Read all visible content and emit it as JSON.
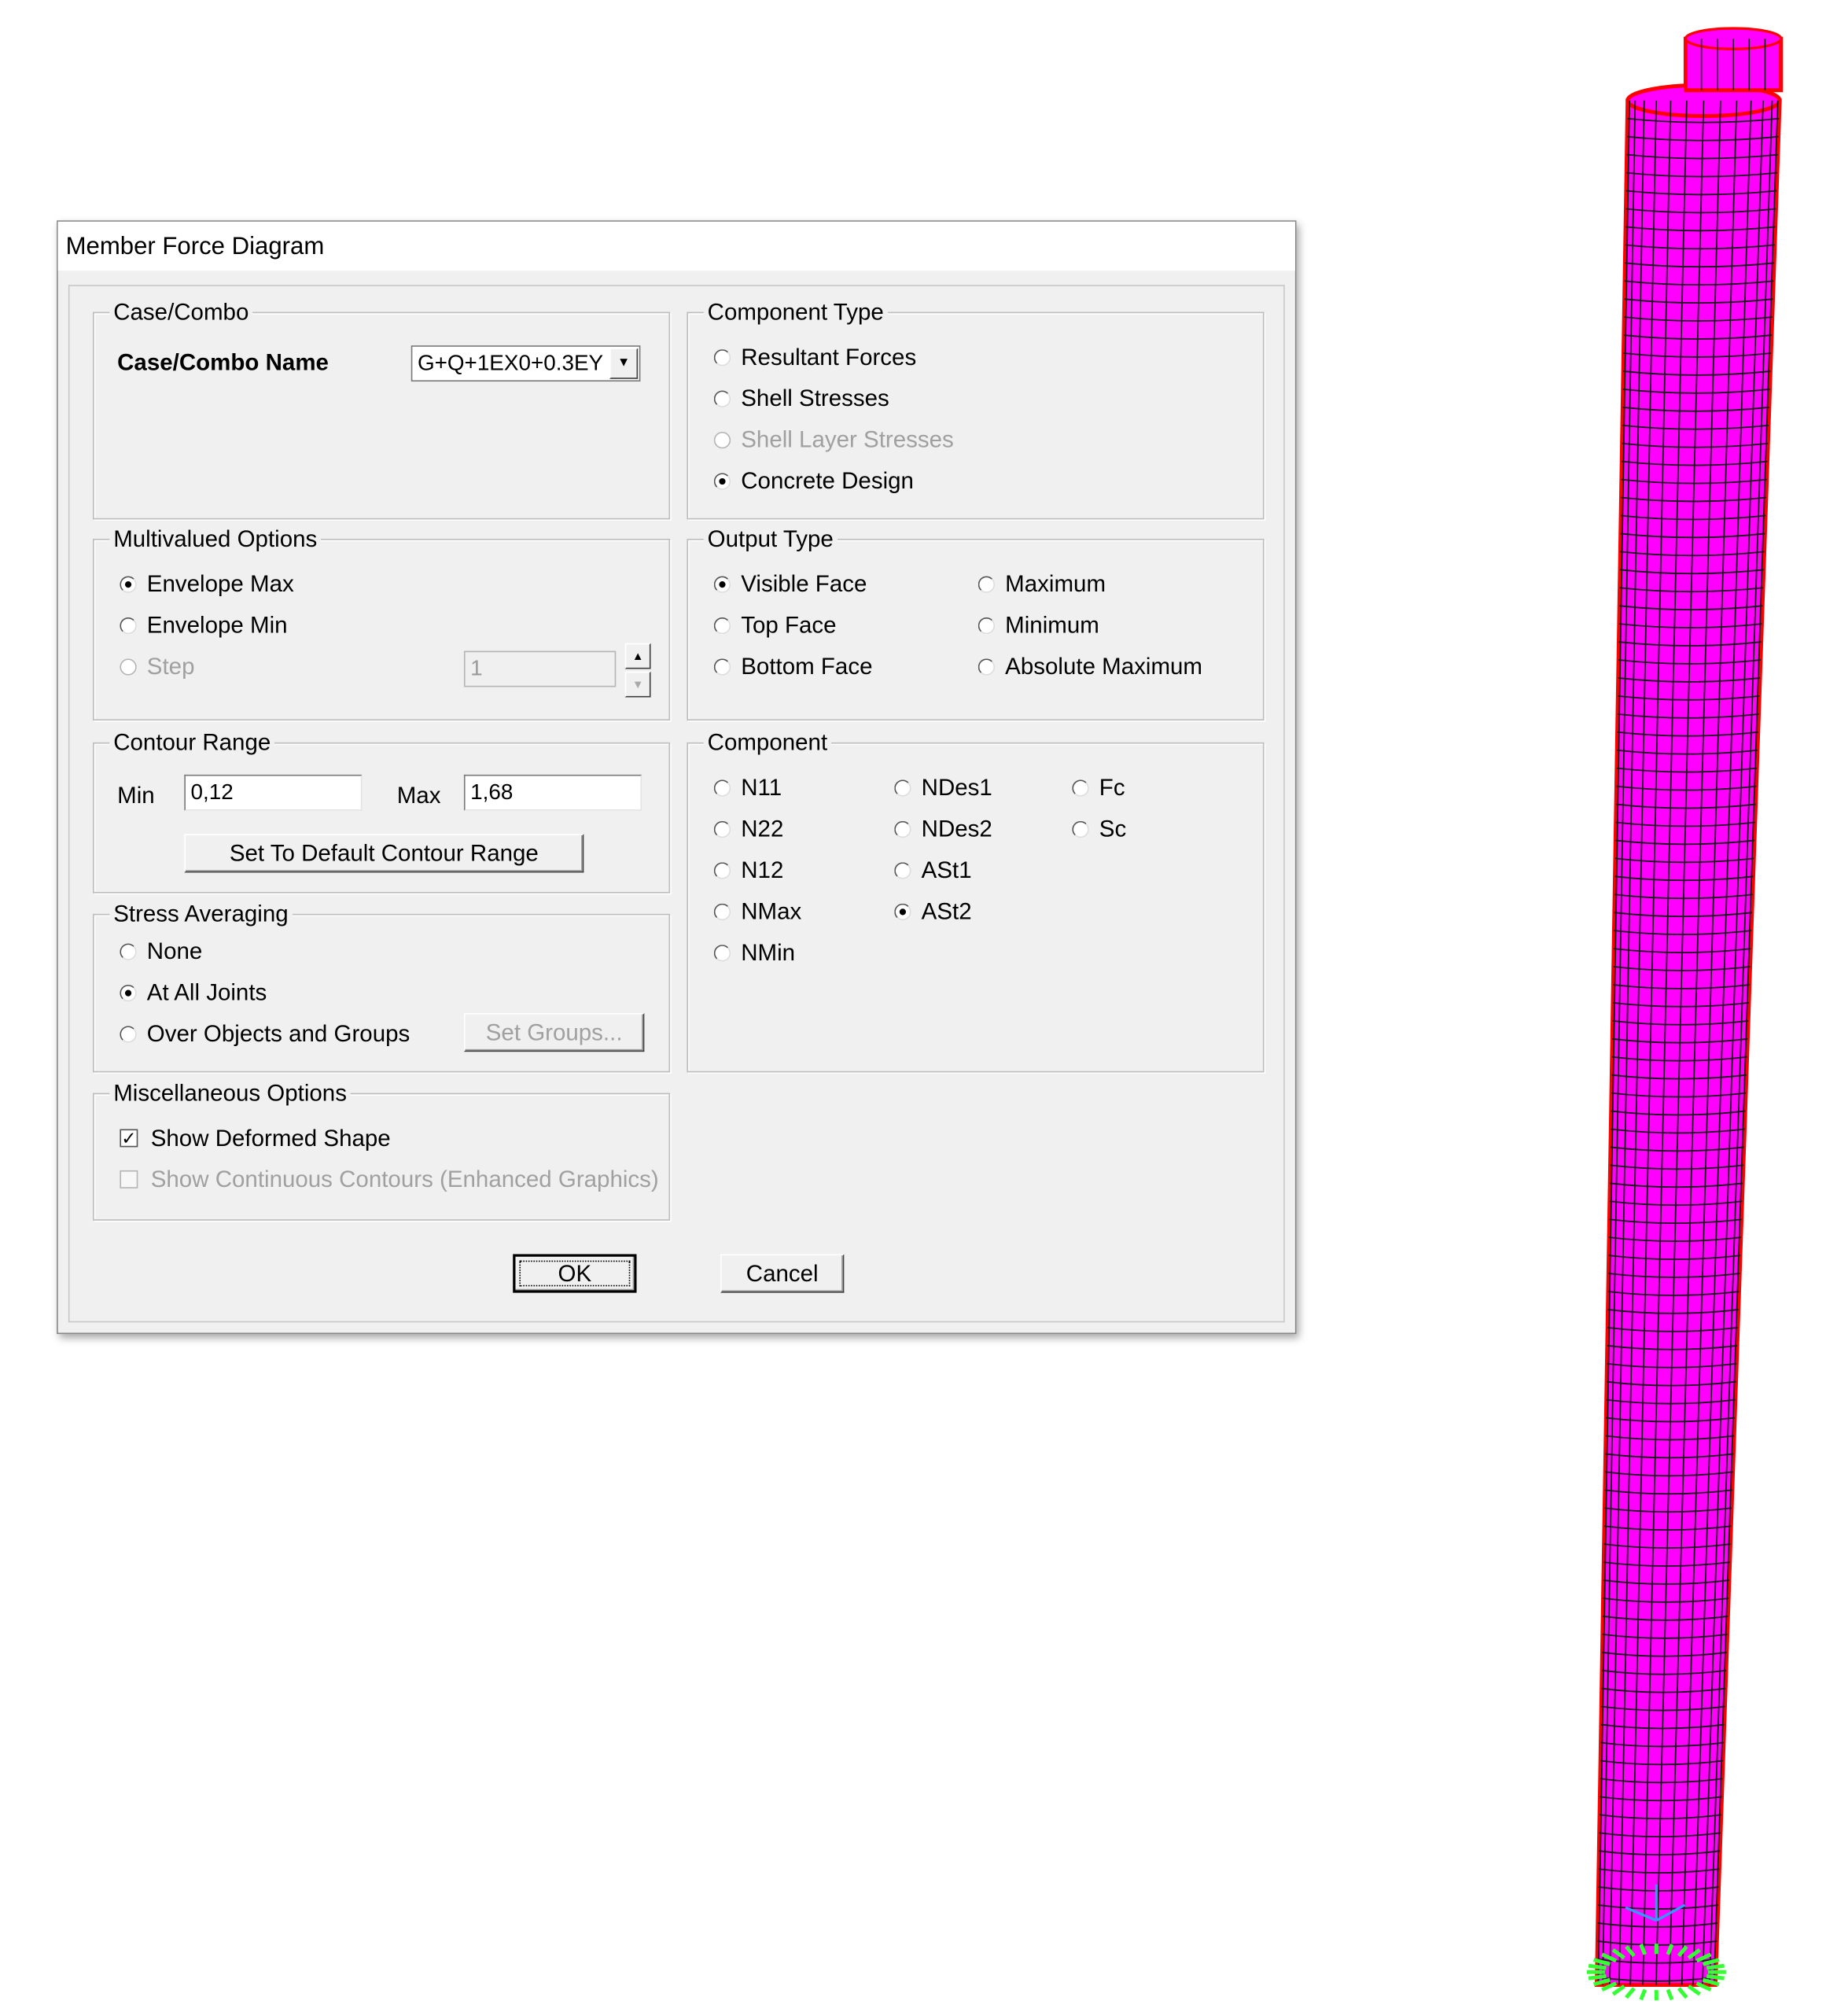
{
  "dialog": {
    "title": "Member Force Diagram",
    "case_combo": {
      "legend": "Case/Combo",
      "name_label": "Case/Combo Name",
      "selected": "G+Q+1EX0+0.3EY"
    },
    "multivalued": {
      "legend": "Multivalued Options",
      "options": [
        "Envelope Max",
        "Envelope Min",
        "Step"
      ],
      "selected": "Envelope Max",
      "step_value": "1"
    },
    "contour_range": {
      "legend": "Contour Range",
      "min_label": "Min",
      "min_value": "0,12",
      "max_label": "Max",
      "max_value": "1,68",
      "default_button": "Set To Default Contour Range"
    },
    "stress_averaging": {
      "legend": "Stress Averaging",
      "options": [
        "None",
        "At All Joints",
        "Over Objects and Groups"
      ],
      "selected": "At All Joints",
      "set_groups_button": "Set Groups..."
    },
    "misc": {
      "legend": "Miscellaneous Options",
      "show_deformed": "Show Deformed Shape",
      "show_deformed_checked": true,
      "show_continuous": "Show Continuous Contours  (Enhanced Graphics)",
      "show_continuous_checked": false
    },
    "component_type": {
      "legend": "Component Type",
      "options": [
        "Resultant Forces",
        "Shell Stresses",
        "Shell Layer Stresses",
        "Concrete Design"
      ],
      "selected": "Concrete Design"
    },
    "output_type": {
      "legend": "Output Type",
      "options": [
        "Visible Face",
        "Top Face",
        "Bottom Face",
        "Maximum",
        "Minimum",
        "Absolute Maximum"
      ],
      "selected": "Visible Face"
    },
    "component": {
      "legend": "Component",
      "options": [
        "N11",
        "N22",
        "N12",
        "NMax",
        "NMin",
        "NDes1",
        "NDes2",
        "ASt1",
        "ASt2",
        "Fc",
        "Sc"
      ],
      "selected": "ASt2"
    },
    "ok_button": "OK",
    "cancel_button": "Cancel"
  },
  "model_view": {
    "mesh_color": "#ff00ff",
    "edge_color": "#ff0000",
    "grid_color": "#1a1a1a",
    "support_color": "#33ff33",
    "axes_color": "#3399ff"
  }
}
